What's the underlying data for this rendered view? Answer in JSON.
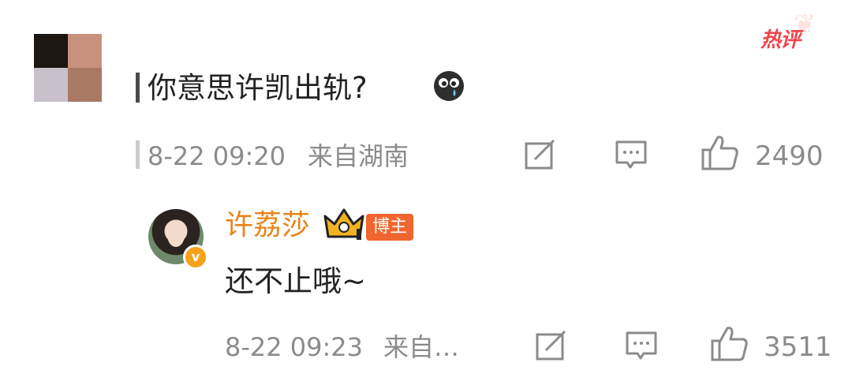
{
  "hot_badge": {
    "label": "热评",
    "color": "#f0444a"
  },
  "top_comment": {
    "avatar_mosaic_colors": [
      "#1c1712",
      "#c8917c",
      "#c8c0ca",
      "#a97964"
    ],
    "text": "你意思许凯出轨?",
    "emoji_icon": "crying-emoji-icon",
    "date": "8-22 09:20",
    "location": "来自湖南",
    "likes": "2490"
  },
  "reply": {
    "username": "许荔莎",
    "badge_label": "博主",
    "text": "还不止哦~",
    "date": "8-22 09:23",
    "location": "来自…",
    "likes": "3511",
    "verified_mark": "v"
  },
  "colors": {
    "username": "#e8841c",
    "meta": "#8b8b8b",
    "tag_bg": "#f0662e"
  }
}
